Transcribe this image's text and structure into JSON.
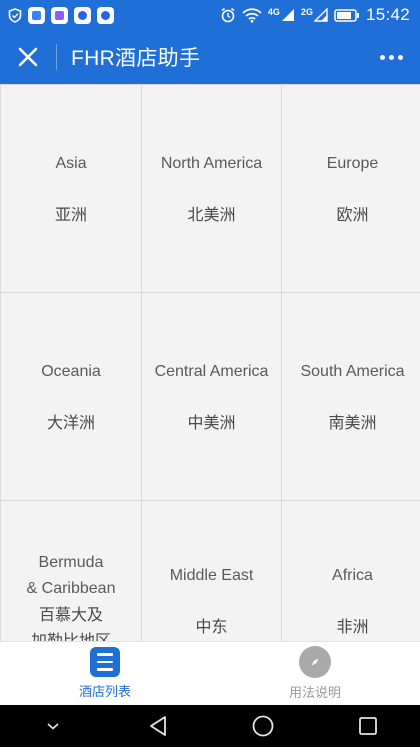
{
  "status_bar": {
    "network_1": "4G",
    "network_2": "2G",
    "time": "15:42",
    "colors": {
      "background": "#1f6fd6",
      "icon_purple": "#8b5cf6",
      "icon_blue": "#3b82f6"
    }
  },
  "header": {
    "title": "FHR酒店助手",
    "close_icon": "close-icon",
    "more_icon": "more-dots-icon",
    "background_color": "#1f6fd6"
  },
  "regions": [
    {
      "en": "Asia",
      "zh": "亚洲"
    },
    {
      "en": "North America",
      "zh": "北美洲"
    },
    {
      "en": "Europe",
      "zh": "欧洲"
    },
    {
      "en": "Oceania",
      "zh": "大洋洲"
    },
    {
      "en": "Central America",
      "zh": "中美洲"
    },
    {
      "en": "South America",
      "zh": "南美洲"
    },
    {
      "en": "Bermuda\n& Caribbean",
      "zh": "百慕大及\n加勒比地区"
    },
    {
      "en": "Middle East",
      "zh": "中东"
    },
    {
      "en": "Africa",
      "zh": "非洲"
    }
  ],
  "tabs": [
    {
      "label": "酒店列表",
      "icon": "hotel-list-icon",
      "active": true
    },
    {
      "label": "用法说明",
      "icon": "compass-icon",
      "active": false
    }
  ],
  "nav_bar": {
    "back_icon": "back-triangle-icon",
    "home_icon": "home-circle-icon",
    "recents_icon": "recents-square-icon"
  }
}
